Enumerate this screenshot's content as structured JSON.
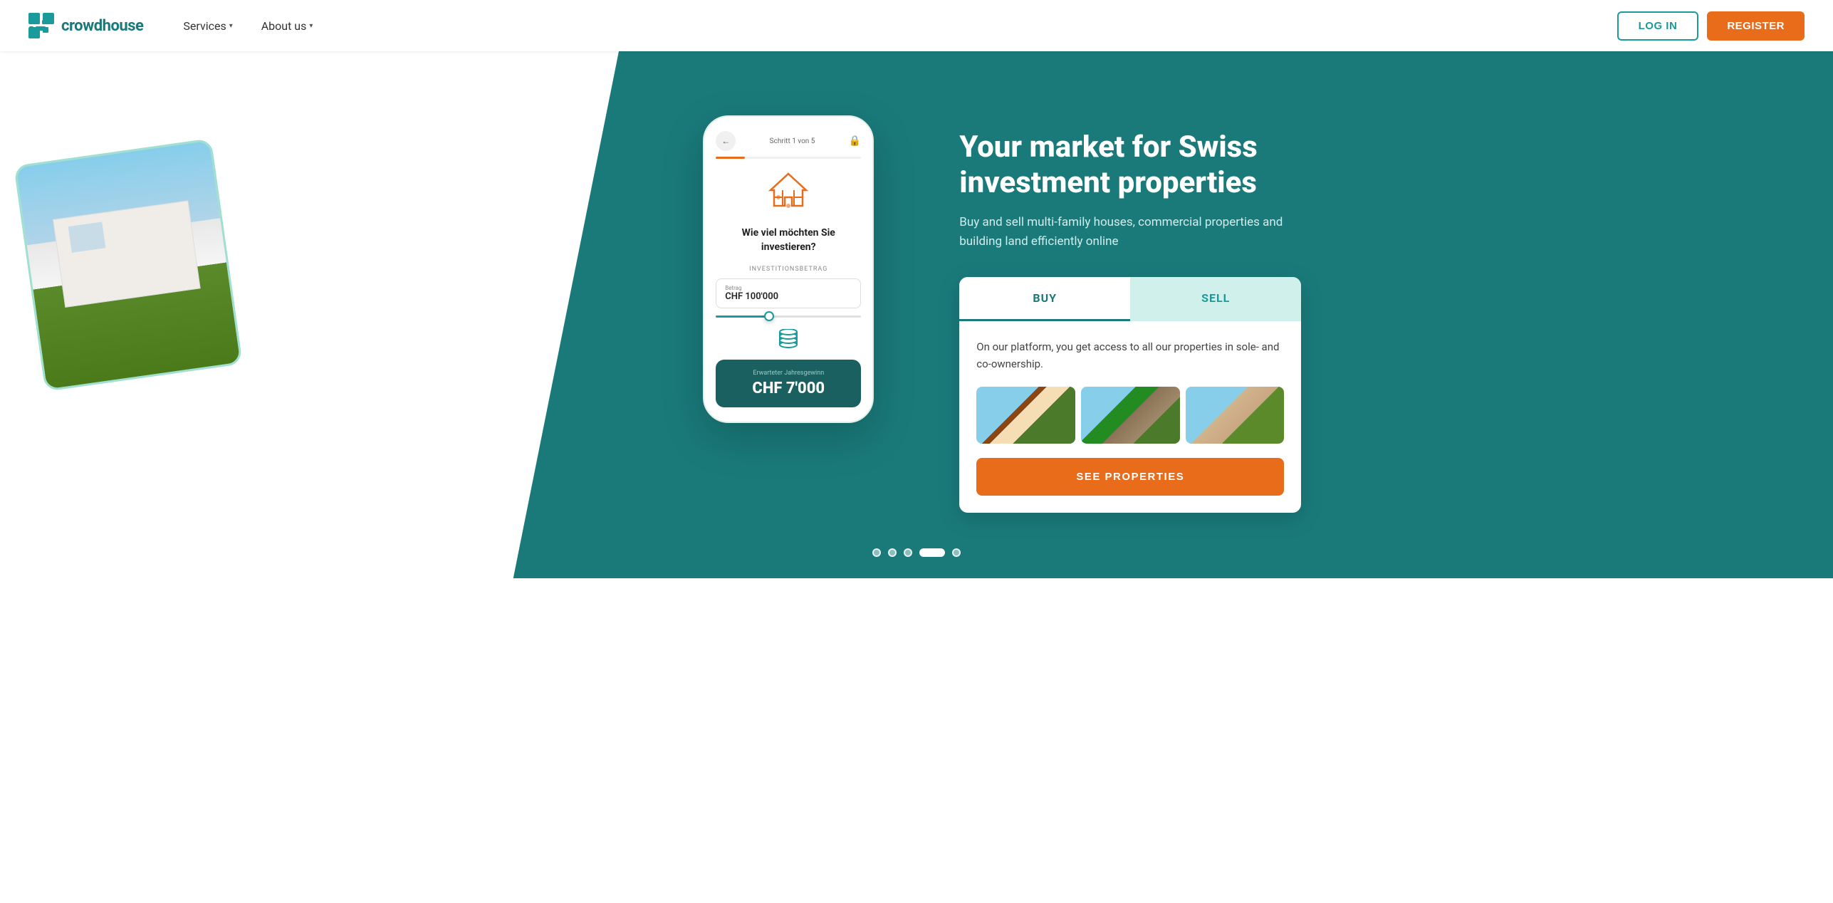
{
  "brand": {
    "name": "crowdhouse"
  },
  "nav": {
    "services_label": "Services",
    "about_label": "About us"
  },
  "header_actions": {
    "login_label": "LOG IN",
    "register_label": "REGISTER"
  },
  "hero": {
    "title": "Your market for Swiss investment properties",
    "subtitle": "Buy and sell multi-family houses, commercial properties and building land efficiently online",
    "buy_tab": "BUY",
    "sell_tab": "SELL",
    "widget_desc": "On our platform, you get access to all our properties in sole- and co-ownership.",
    "see_properties_label": "SEE PROPERTIES"
  },
  "phone": {
    "step_text": "Schritt 1 von 5",
    "question": "Wie viel möchten Sie investieren?",
    "investment_label": "INVESTITIONSBETRAG",
    "betrag_label": "Betrag",
    "amount_value": "CHF 100'000",
    "result_label": "Erwarteter Jahresgewinn",
    "result_value": "CHF 7'000"
  },
  "dots": {
    "count": 5,
    "active_index": 3
  }
}
